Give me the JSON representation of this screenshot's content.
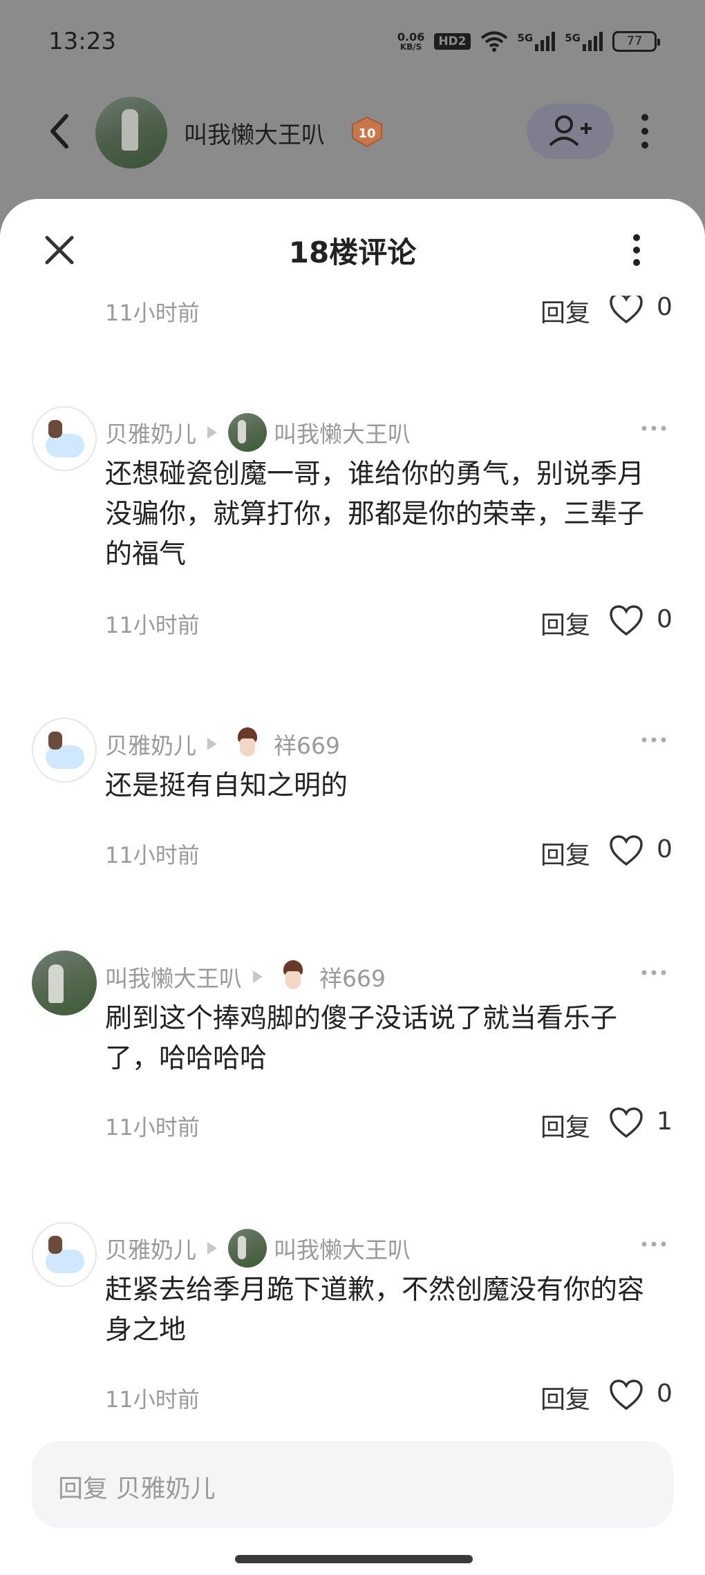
{
  "status_bar": {
    "time": "13:23",
    "net_speed_value": "0.06",
    "net_speed_unit": "KB/S",
    "hd": "HD2",
    "signal1": "5G",
    "signal2": "5G",
    "battery": "77"
  },
  "background_header": {
    "username": "叫我懒大王叭",
    "level": "10"
  },
  "sheet": {
    "title": "18楼评论"
  },
  "top_partial": {
    "time": "11小时前",
    "reply": "回复",
    "likes": "0"
  },
  "comments": [
    {
      "author": "贝雅奶儿",
      "target": "叫我懒大王叭",
      "text": "还想碰瓷创魔一哥，谁给你的勇气，别说季月没骗你，就算打你，那都是你的荣幸，三辈子的福气",
      "time": "11小时前",
      "reply": "回复",
      "likes": "0"
    },
    {
      "author": "贝雅奶儿",
      "target": "祥669",
      "text": "还是挺有自知之明的",
      "time": "11小时前",
      "reply": "回复",
      "likes": "0"
    },
    {
      "author": "叫我懒大王叭",
      "target": "祥669",
      "text": "刷到这个捧鸡脚的傻子没话说了就当看乐子了，哈哈哈哈",
      "time": "11小时前",
      "reply": "回复",
      "likes": "1"
    },
    {
      "author": "贝雅奶儿",
      "target": "叫我懒大王叭",
      "text": "赶紧去给季月跪下道歉，不然创魔没有你的容身之地",
      "time": "11小时前",
      "reply": "回复",
      "likes": "0"
    }
  ],
  "input": {
    "placeholder": "回复 贝雅奶儿"
  }
}
